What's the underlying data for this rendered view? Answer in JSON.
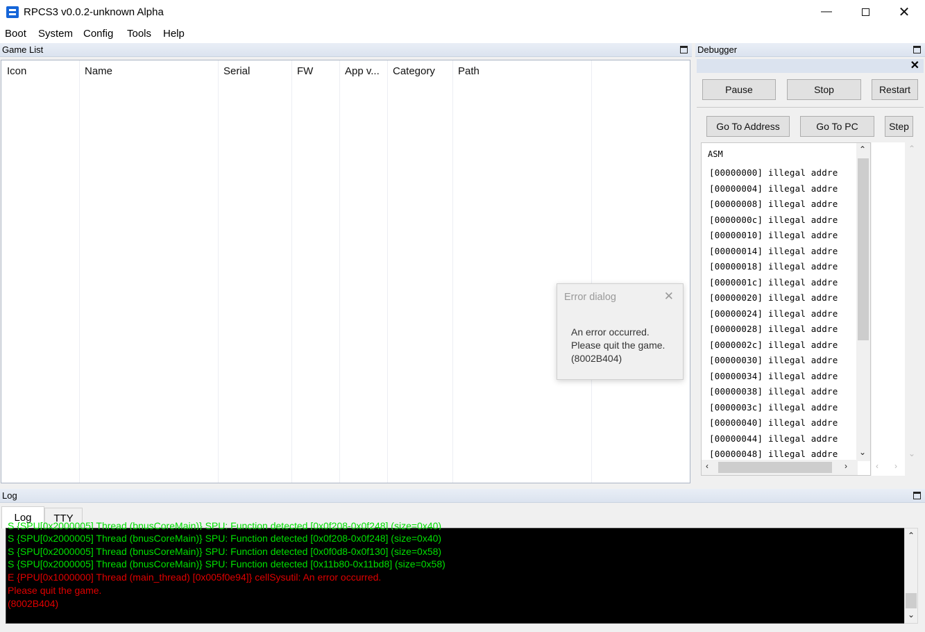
{
  "window": {
    "title": "RPCS3 v0.0.2-unknown Alpha"
  },
  "menu": [
    "Boot",
    "System",
    "Config",
    "Tools",
    "Help"
  ],
  "game_list": {
    "title": "Game List",
    "columns": [
      "Icon",
      "Name",
      "Serial",
      "FW",
      "App v...",
      "Category",
      "Path"
    ]
  },
  "debugger": {
    "title": "Debugger",
    "buttons_row1": [
      "Pause",
      "Stop",
      "Restart"
    ],
    "buttons_row2": [
      "Go To Address",
      "Go To PC",
      "Step"
    ],
    "asm_header": "ASM",
    "asm_lines": [
      "[00000000] illegal addre",
      "[00000004] illegal addre",
      "[00000008] illegal addre",
      "[0000000c] illegal addre",
      "[00000010] illegal addre",
      "[00000014] illegal addre",
      "[00000018] illegal addre",
      "[0000001c] illegal addre",
      "[00000020] illegal addre",
      "[00000024] illegal addre",
      "[00000028] illegal addre",
      "[0000002c] illegal addre",
      "[00000030] illegal addre",
      "[00000034] illegal addre",
      "[00000038] illegal addre",
      "[0000003c] illegal addre",
      "[00000040] illegal addre",
      "[00000044] illegal addre",
      "[00000048] illegal addre"
    ]
  },
  "error_dialog": {
    "title": "Error dialog",
    "line1": "An error occurred.",
    "line2": "Please quit the game.",
    "line3": "(8002B404)"
  },
  "log": {
    "title": "Log",
    "tabs": [
      "Log",
      "TTY"
    ],
    "lines": [
      {
        "text": "S {SPU[0x2000005] Thread (bnusCoreMain)} SPU: Function detected [0x0f208-0x0f248] (size=0x40)",
        "color": "#00e000"
      },
      {
        "text": "S {SPU[0x2000005] Thread (bnusCoreMain)} SPU: Function detected [0x0f0d8-0x0f130] (size=0x58)",
        "color": "#00e000"
      },
      {
        "text": "S {SPU[0x2000005] Thread (bnusCoreMain)} SPU: Function detected [0x11b80-0x11bd8] (size=0x58)",
        "color": "#00e000"
      },
      {
        "text": "E {PPU[0x1000000] Thread (main_thread) [0x005f0e94]} cellSysutil: An error occurred.",
        "color": "#e00000"
      },
      {
        "text": "Please quit the game.",
        "color": "#e00000"
      },
      {
        "text": "(8002B404)",
        "color": "#e00000"
      }
    ]
  },
  "colors": {
    "log_ok": "#00e000",
    "log_error": "#e00000",
    "accent": "#1565d8"
  }
}
